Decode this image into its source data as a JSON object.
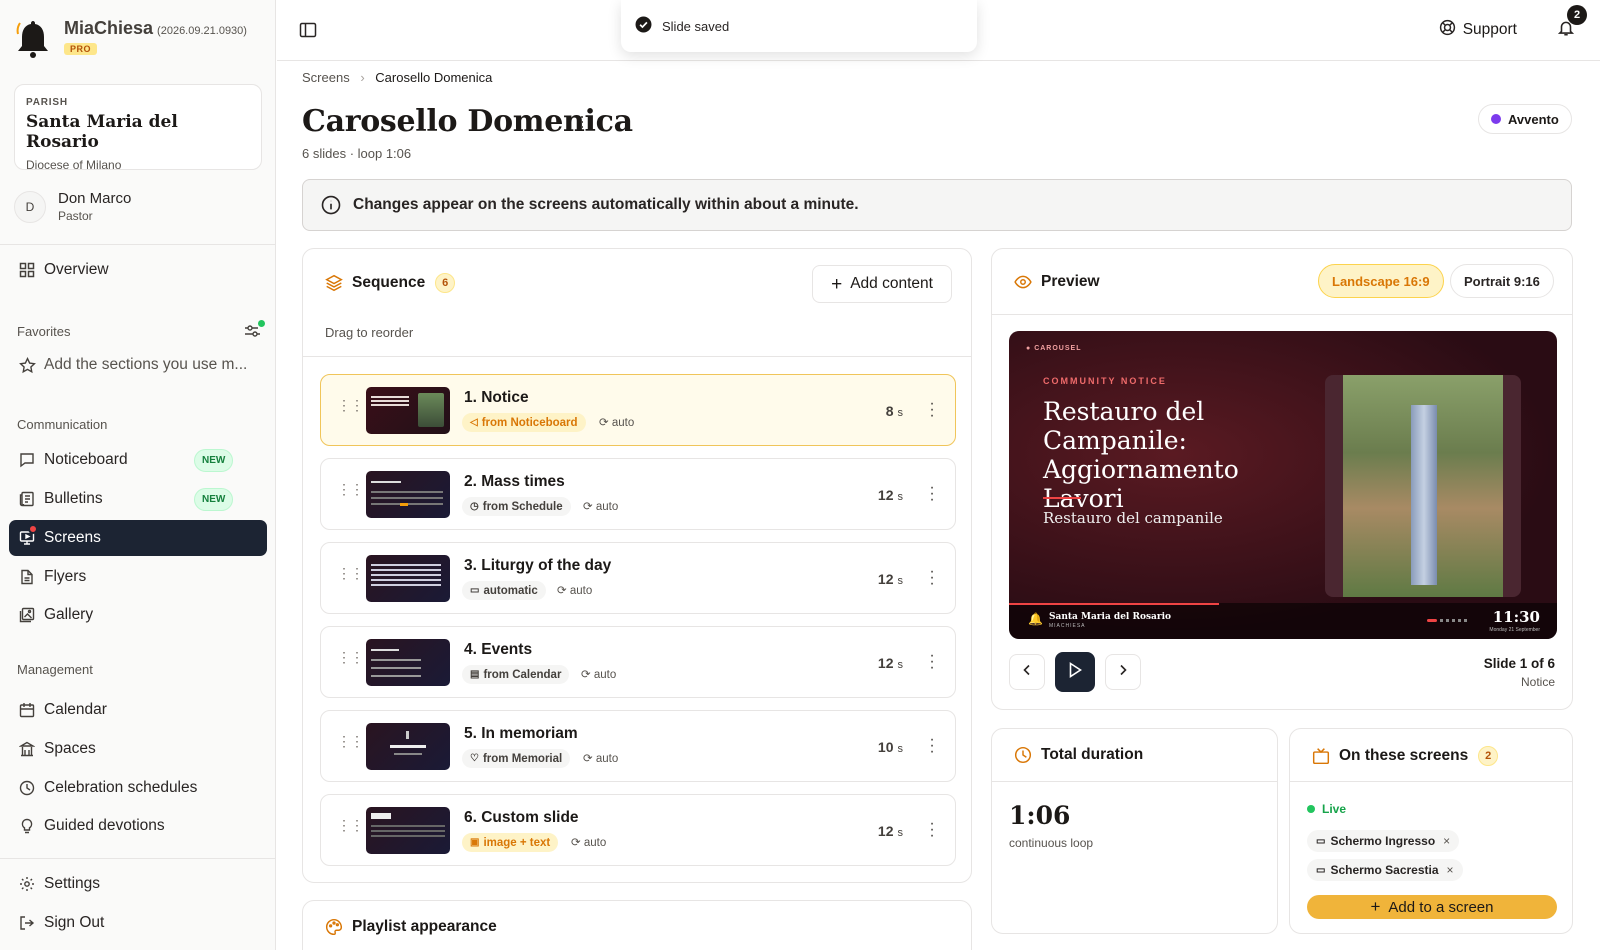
{
  "app": {
    "name": "MiaChiesa",
    "version": "(2026.09.21.0930)",
    "plan": "PRO"
  },
  "parish": {
    "kicker": "PARISH",
    "name": "Santa Maria del Rosario",
    "diocese": "Diocese of Milano"
  },
  "user": {
    "initial": "D",
    "name": "Don Marco",
    "role": "Pastor"
  },
  "nav": {
    "overview": "Overview",
    "favorites_title": "Favorites",
    "favorites_hint": "Add the sections you use m...",
    "communication_title": "Communication",
    "noticeboard": "Noticeboard",
    "bulletins": "Bulletins",
    "screens": "Screens",
    "flyers": "Flyers",
    "gallery": "Gallery",
    "new_badge": "NEW",
    "management_title": "Management",
    "calendar": "Calendar",
    "spaces": "Spaces",
    "celebration_schedules": "Celebration schedules",
    "guided_devotions": "Guided devotions",
    "settings": "Settings",
    "sign_out": "Sign Out"
  },
  "topbar": {
    "support": "Support",
    "notifications": "2"
  },
  "toast": {
    "message": "Slide saved"
  },
  "breadcrumb": {
    "parent": "Screens",
    "current": "Carosello Domenica"
  },
  "page": {
    "title": "Carosello Domenica",
    "subtitle": "6 slides · loop 1:06",
    "season": "Avvento",
    "season_color": "#7c3aed"
  },
  "info_banner": "Changes appear on the screens automatically within about a minute.",
  "sequence": {
    "title": "Sequence",
    "count": "6",
    "add_label": "Add content",
    "hint": "Drag to reorder",
    "slides": [
      {
        "title": "1. Notice",
        "source": "from Noticeboard",
        "source_icon": "megaphone-icon",
        "mode": "auto",
        "seconds": "8",
        "unit": "s"
      },
      {
        "title": "2. Mass times",
        "source": "from Schedule",
        "source_icon": "clock-icon",
        "mode": "auto",
        "seconds": "12",
        "unit": "s"
      },
      {
        "title": "3. Liturgy of the day",
        "source": "automatic",
        "source_icon": "book-icon",
        "mode": "auto",
        "seconds": "12",
        "unit": "s"
      },
      {
        "title": "4. Events",
        "source": "from Calendar",
        "source_icon": "calendar-icon",
        "mode": "auto",
        "seconds": "12",
        "unit": "s"
      },
      {
        "title": "5. In memoriam",
        "source": "from Memorial",
        "source_icon": "heart-icon",
        "mode": "auto",
        "seconds": "10",
        "unit": "s"
      },
      {
        "title": "6. Custom slide",
        "source": "image + text",
        "source_icon": "image-icon",
        "mode": "auto",
        "seconds": "12",
        "unit": "s"
      }
    ]
  },
  "appearance": {
    "title": "Playlist appearance"
  },
  "preview": {
    "title": "Preview",
    "landscape": "Landscape 16:9",
    "portrait": "Portrait 9:16",
    "slide": {
      "brand_tag": "CAROUSEL",
      "kicker": "COMMUNITY NOTICE",
      "headline": "Restauro del Campanile: Aggiornamento Lavori",
      "subhead": "Restauro del campanile",
      "footer_parish": "Santa Maria del Rosario",
      "footer_app": "MIACHIESA",
      "time": "11:30",
      "date": "Monday 21 September"
    },
    "position": "Slide 1 of 6",
    "current_name": "Notice"
  },
  "duration": {
    "title": "Total duration",
    "value": "1:06",
    "caption": "continuous loop"
  },
  "screens": {
    "title": "On these screens",
    "count": "2",
    "status": "Live",
    "items": [
      "Schermo Ingresso",
      "Schermo Sacrestia"
    ],
    "add_label": "Add to a screen"
  }
}
